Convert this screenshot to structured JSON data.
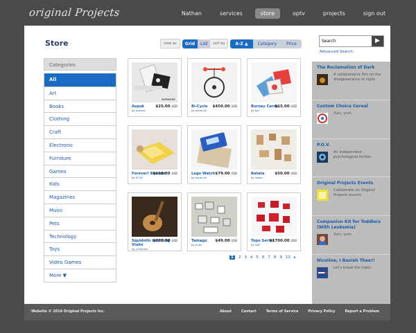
{
  "brand": {
    "logo": "original Projects"
  },
  "topnav": [
    "Nathan",
    "services",
    "store",
    "optv",
    "projects",
    "sign out"
  ],
  "topnav_active": "store",
  "page": {
    "title": "Store"
  },
  "viewas": {
    "label": "view as",
    "grid": "Grid",
    "list": "List"
  },
  "sortby": {
    "label": "sort by",
    "az": "A-Z ▲",
    "category": "Category",
    "price": "Price"
  },
  "categories": {
    "header": "Categories",
    "items": [
      "All",
      "Art",
      "Books",
      "Clothing",
      "Craft",
      "Electronic",
      "Furniture",
      "Games",
      "Kids",
      "Magazines",
      "Music",
      "Pets",
      "Technology",
      "Toys",
      "Video Games"
    ],
    "more": "More ▼"
  },
  "products": [
    {
      "name": "Aspuk",
      "by": "by",
      "author": "tamera",
      "price": "$25.00",
      "cur": "USD",
      "patent": "PATENTED"
    },
    {
      "name": "Bi-Cycle",
      "by": "by",
      "author": "alamuch",
      "price": "$450.00",
      "cur": "USD"
    },
    {
      "name": "Burney Cards",
      "by": "by",
      "author": "bar",
      "price": "$15.00",
      "cur": "USD"
    },
    {
      "name": "Forever! Blanket",
      "by": "by",
      "author": "ECXY",
      "price": "$110.00",
      "cur": "USD"
    },
    {
      "name": "Lego Watch",
      "by": "by",
      "author": "alamuch",
      "price": "$79.00",
      "cur": "USD"
    },
    {
      "name": "Batata",
      "by": "by",
      "author": "Yowie",
      "price": "$50.00",
      "cur": "USD"
    },
    {
      "name": "Squidolin Learning Violin",
      "by": "by",
      "author": "crmavlus",
      "price": "$738.00",
      "cur": "USD"
    },
    {
      "name": "Tamago",
      "by": "by",
      "author": "nuez",
      "price": "$49.00",
      "cur": "USD"
    },
    {
      "name": "Topo Series",
      "by": "by",
      "author": "ABC",
      "price": "$1700.00",
      "cur": "USD"
    }
  ],
  "pager": {
    "pages": [
      "1",
      "2",
      "3",
      "4",
      "5",
      "6",
      "7",
      "8",
      "9",
      "10"
    ],
    "next": "▸"
  },
  "search": {
    "value": "Search",
    "advanced": "Advanced Search"
  },
  "events": [
    {
      "title": "The Reclamation of Dark",
      "desc": "A collaborative film on the disappearance of night."
    },
    {
      "title": "Custom Choice Cereal",
      "desc": "Yum, yum."
    },
    {
      "title": "P.O.V.",
      "desc": "An independent psychological thriller."
    },
    {
      "title": "Original Projects Events",
      "desc": "Collaborate on Original Projects events."
    },
    {
      "title": "Companion Kit for Toddlers (With Leukemia)",
      "desc": "Yum, yum."
    },
    {
      "title": "Nicotine, I Banish Thee!!",
      "desc": "Let's break the habit."
    }
  ],
  "footer": {
    "copyright": "Website © 2010 Original Projects Inc.",
    "links": [
      "About",
      "Contact",
      "Terms of Service",
      "Privacy Policy",
      "Report a Problem"
    ]
  },
  "colors": {
    "accent": "#1a6bc4",
    "sidebar": "#bcbcbc",
    "frame": "#4a4a4a"
  }
}
